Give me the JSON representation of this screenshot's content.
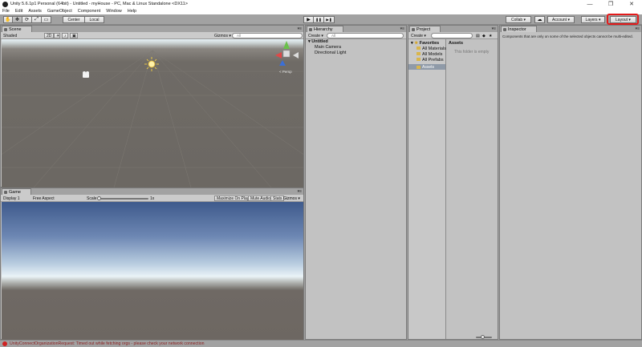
{
  "window": {
    "title": "Unity 5.6.1p1 Personal (64bit) - Untitled - myHouse - PC, Mac & Linux Standalone <DX11>",
    "minimize": "—",
    "restore": "❐",
    "close": "✕"
  },
  "menu": [
    "File",
    "Edit",
    "Assets",
    "GameObject",
    "Component",
    "Window",
    "Help"
  ],
  "toolbar": {
    "hand": "✋",
    "move": "✥",
    "rotate": "⟳",
    "scale": "⤢",
    "rect": "▭",
    "pivot_center": "Center",
    "pivot_space": "Local",
    "play": "▶",
    "pause": "❚❚",
    "step": "▶❚",
    "collab": "Collab ▾",
    "cloud": "☁",
    "account": "Account ▾",
    "layers": "Layers ▾",
    "layout": "Layout ▾"
  },
  "scene": {
    "tab": "Scene",
    "shading": "Shaded",
    "mode_2d": "2D",
    "gizmos": "Gizmos ▾",
    "search_placeholder": "All",
    "persp": "< Persp"
  },
  "game": {
    "tab": "Game",
    "display": "Display 1",
    "aspect": "Free Aspect",
    "scale_label": "Scale",
    "scale_value": "1x",
    "maximize": "Maximize On Play",
    "mute": "Mute Audio",
    "stats": "Stats",
    "gizmos": "Gizmos ▾"
  },
  "hierarchy": {
    "tab": "Hierarchy",
    "create": "Create ▾",
    "search_placeholder": "All",
    "scene_name": "Untitled",
    "items": [
      "Main Camera",
      "Directional Light"
    ]
  },
  "project": {
    "tab": "Project",
    "create": "Create ▾",
    "favorites": "Favorites",
    "favorite_items": [
      "All Materials",
      "All Models",
      "All Prefabs"
    ],
    "assets_header": "Assets",
    "assets_folder": "Assets",
    "empty_message": "This folder is empty"
  },
  "inspector": {
    "tab": "Inspector",
    "message": "Components that are only on some of the selected objects cannot be multi-edited."
  },
  "status": {
    "message": "UnityConnectOrganizationRequest: Timed out while fetching orgs - please check your network connection"
  }
}
